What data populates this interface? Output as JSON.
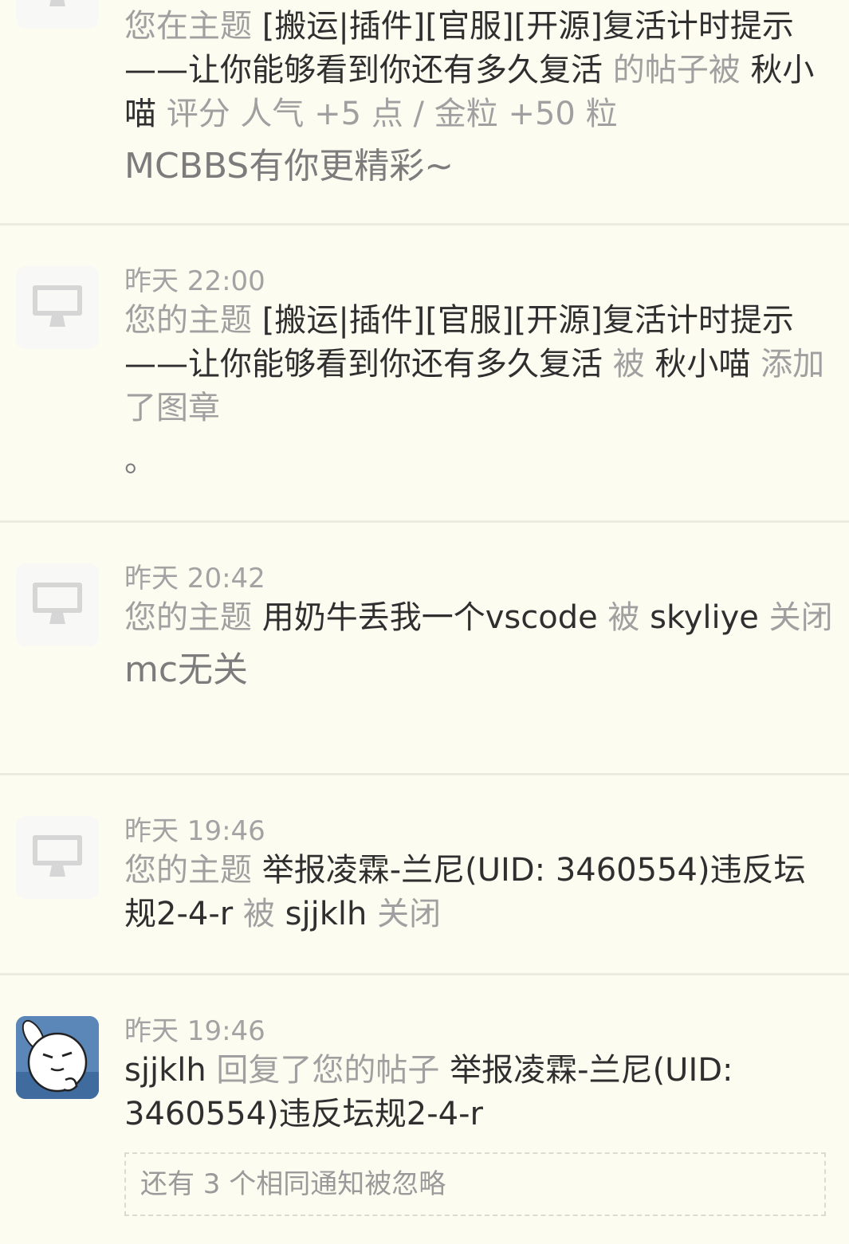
{
  "notifications": [
    {
      "time": "",
      "p1": "您在主题 ",
      "subject": "[搬运|插件][官服][开源]复活计时提示——让你能够看到你还有多久复活",
      "p2": " 的帖子被 ",
      "user": "秋小喵",
      "p3": " 评分 人气 +5 点 / 金粒 +50 粒",
      "note": "MCBBS有你更精彩~"
    },
    {
      "time": "昨天 22:00",
      "p1": "您的主题 ",
      "subject": "[搬运|插件][官服][开源]复活计时提示——让你能够看到你还有多久复活",
      "p2": " 被 ",
      "user": "秋小喵",
      "p3": " 添加了图章",
      "note": "。"
    },
    {
      "time": "昨天 20:42",
      "p1": "您的主题 ",
      "subject": "用奶牛丢我一个vscode",
      "p2": " 被 ",
      "user": "skyliye",
      "p3": " 关闭",
      "note": "mc无关"
    },
    {
      "time": "昨天 19:46",
      "p1": "您的主题 ",
      "subject": "举报凌霖-兰尼(UID: 3460554)违反坛规2-4-r",
      "p2": " 被 ",
      "user": "sjjklh",
      "p3": " 关闭",
      "note": ""
    },
    {
      "time": "昨天 19:46",
      "user": "sjjklh",
      "p1": " 回复了您的帖子 ",
      "subject": "举报凌霖-兰尼(UID: 3460554)违反坛规2-4-r",
      "ignored": "还有 3 个相同通知被忽略"
    }
  ],
  "colors": {
    "background": "#fdfcf1",
    "highlight_text": "#2f2f2f",
    "muted_text": "#a0a0a0"
  }
}
